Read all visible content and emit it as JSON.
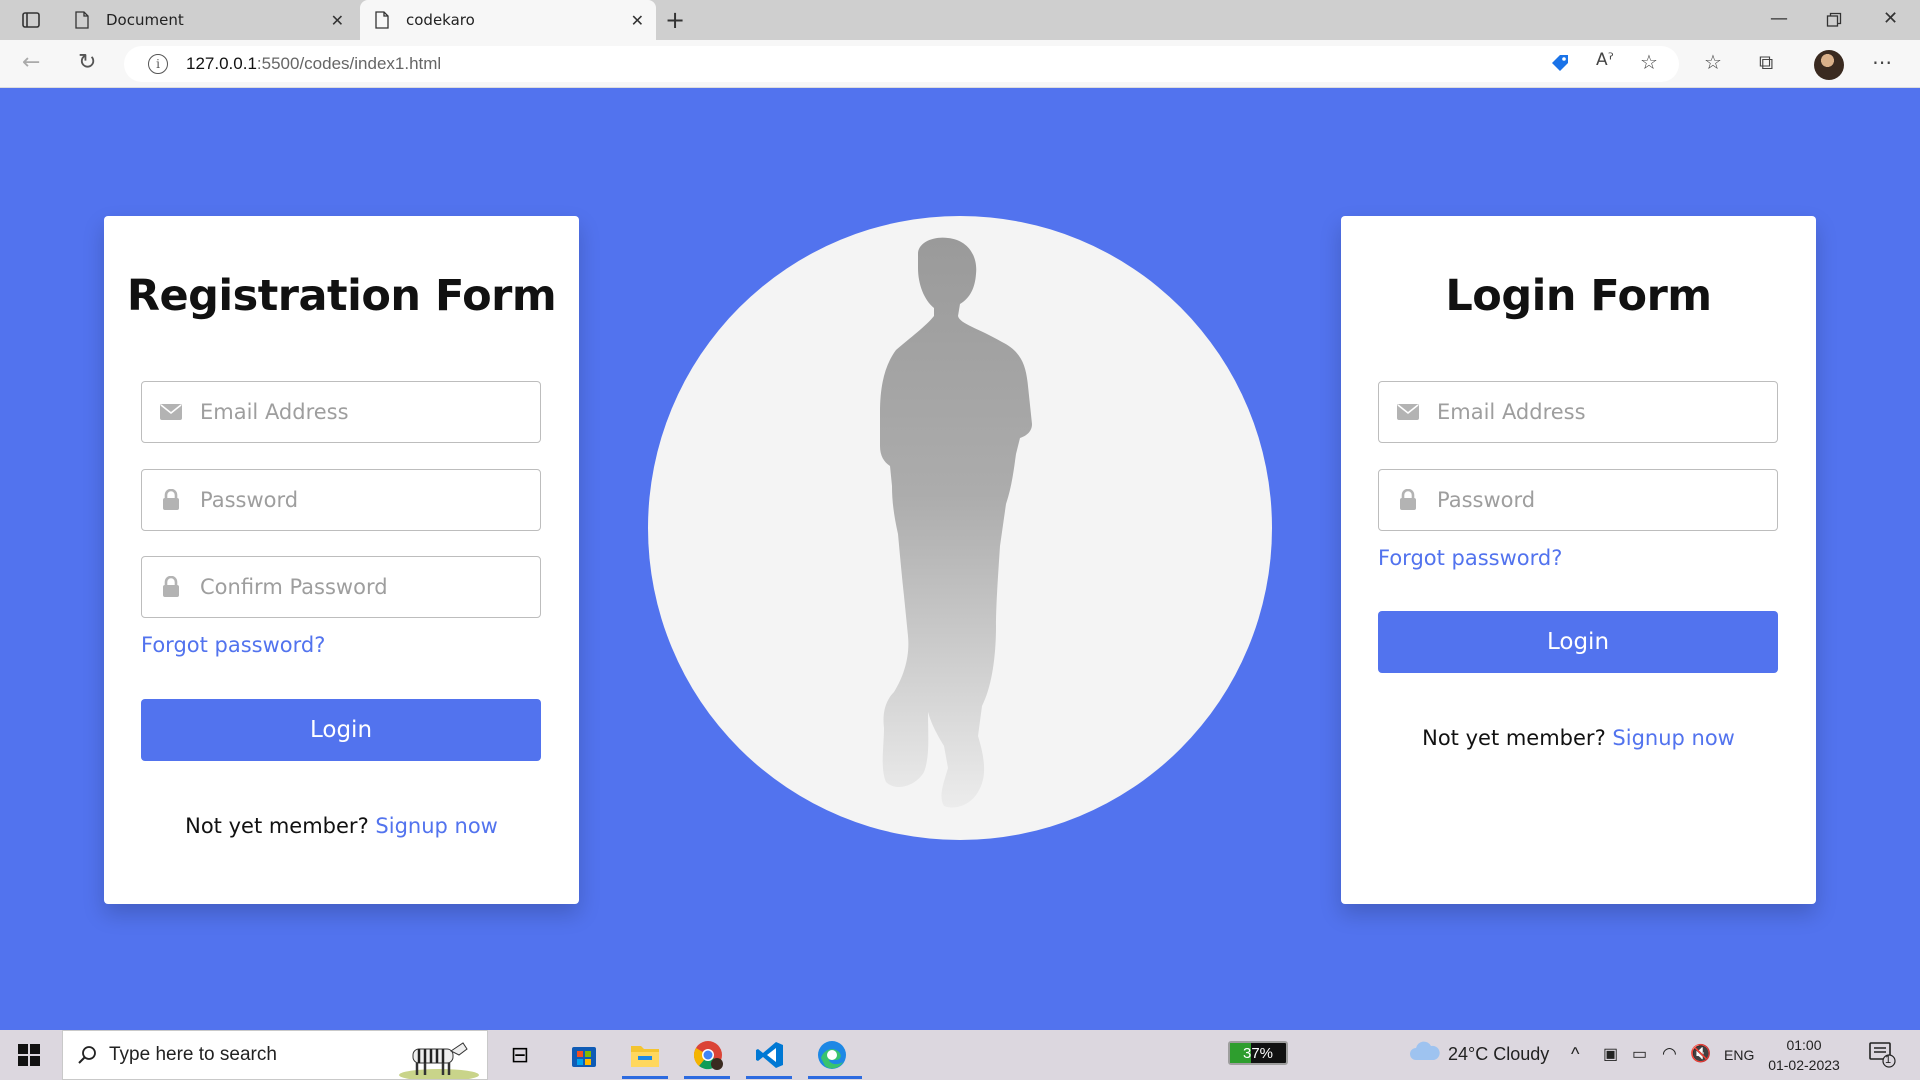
{
  "browser": {
    "tabs": [
      {
        "title": "Document",
        "active": false
      },
      {
        "title": "codekaro",
        "active": true
      }
    ],
    "url_host": "127.0.0.1",
    "url_path": ":5500/codes/index1.html",
    "read_aloud_label": "Aˀ"
  },
  "registration": {
    "title": "Registration Form",
    "email_placeholder": "Email Address",
    "password_placeholder": "Password",
    "confirm_placeholder": "Confirm Password",
    "forgot_link": "Forgot password?",
    "button_label": "Login",
    "signup_prefix": "Not yet member?",
    "signup_link": "Signup now"
  },
  "login": {
    "title": "Login Form",
    "email_placeholder": "Email Address",
    "password_placeholder": "Password",
    "forgot_link": "Forgot password?",
    "button_label": "Login",
    "signup_prefix": "Not yet member?",
    "signup_link": "Signup now"
  },
  "colors": {
    "page_bg": "#5273ee",
    "accent": "#5273ee",
    "card_bg": "#ffffff",
    "circle_bg": "#f4f4f4"
  },
  "taskbar": {
    "search_placeholder": "Type here to search",
    "battery_text": "37%",
    "battery_level": 0.37,
    "weather": "24°C  Cloudy",
    "language": "ENG",
    "time": "01:00",
    "date": "01-02-2023",
    "notification_count": "1",
    "pinned_icons": [
      "task-view-icon",
      "store-icon",
      "file-explorer-icon",
      "chrome-icon",
      "vscode-icon",
      "edge-icon"
    ]
  }
}
